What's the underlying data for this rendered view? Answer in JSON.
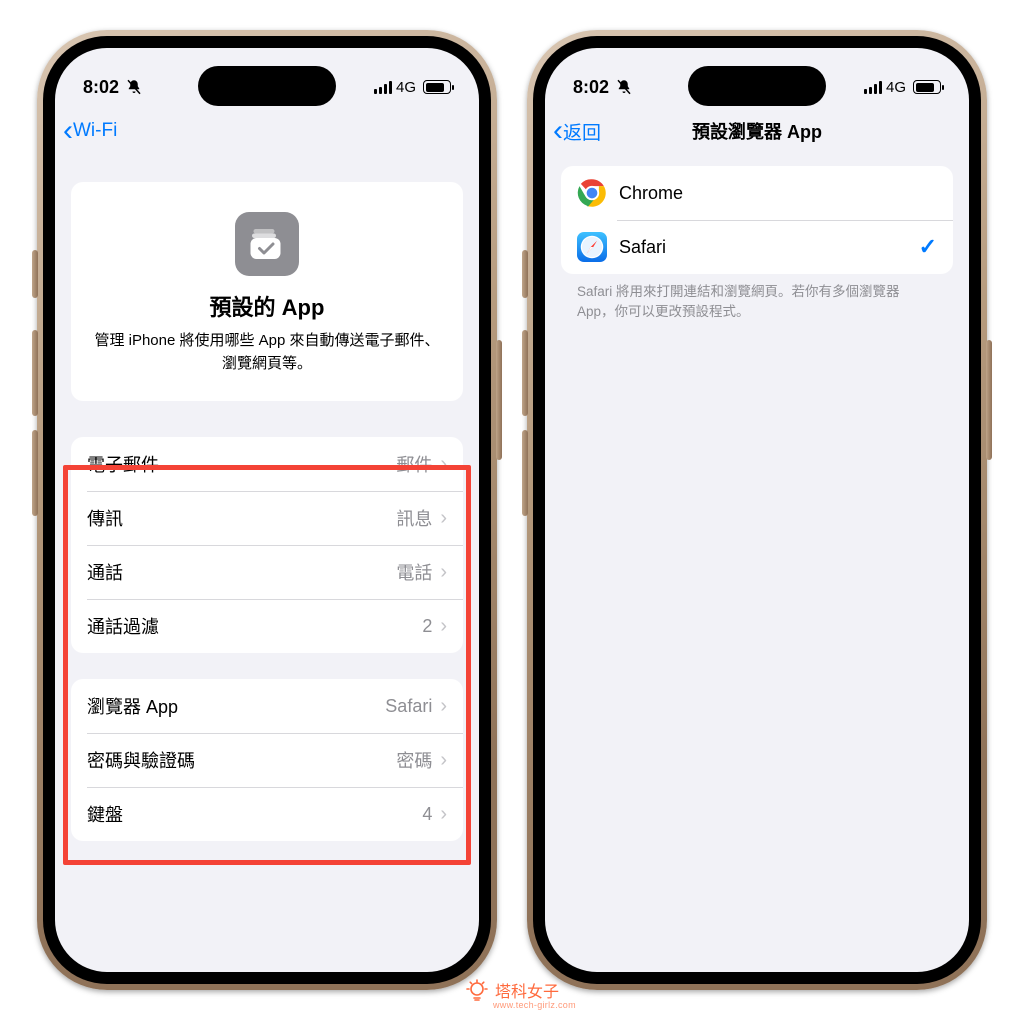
{
  "status": {
    "time": "8:02",
    "net": "4G"
  },
  "phone1": {
    "back_label": "Wi-Fi",
    "hero_title": "預設的 App",
    "hero_desc": "管理 iPhone 將使用哪些 App 來自動傳送電子郵件、瀏覽網頁等。",
    "group1": [
      {
        "label": "電子郵件",
        "value": "郵件"
      },
      {
        "label": "傳訊",
        "value": "訊息"
      },
      {
        "label": "通話",
        "value": "電話"
      },
      {
        "label": "通話過濾",
        "value": "2"
      }
    ],
    "group2": [
      {
        "label": "瀏覽器 App",
        "value": "Safari"
      },
      {
        "label": "密碼與驗證碼",
        "value": "密碼"
      },
      {
        "label": "鍵盤",
        "value": "4"
      }
    ]
  },
  "phone2": {
    "back_label": "返回",
    "title": "預設瀏覽器 App",
    "items": [
      {
        "name": "Chrome",
        "selected": false
      },
      {
        "name": "Safari",
        "selected": true
      }
    ],
    "footer": "Safari 將用來打開連結和瀏覽網頁。若你有多個瀏覽器 App，你可以更改預設程式。"
  },
  "watermark": {
    "text": "塔科女子",
    "sub": "www.tech-girlz.com"
  }
}
